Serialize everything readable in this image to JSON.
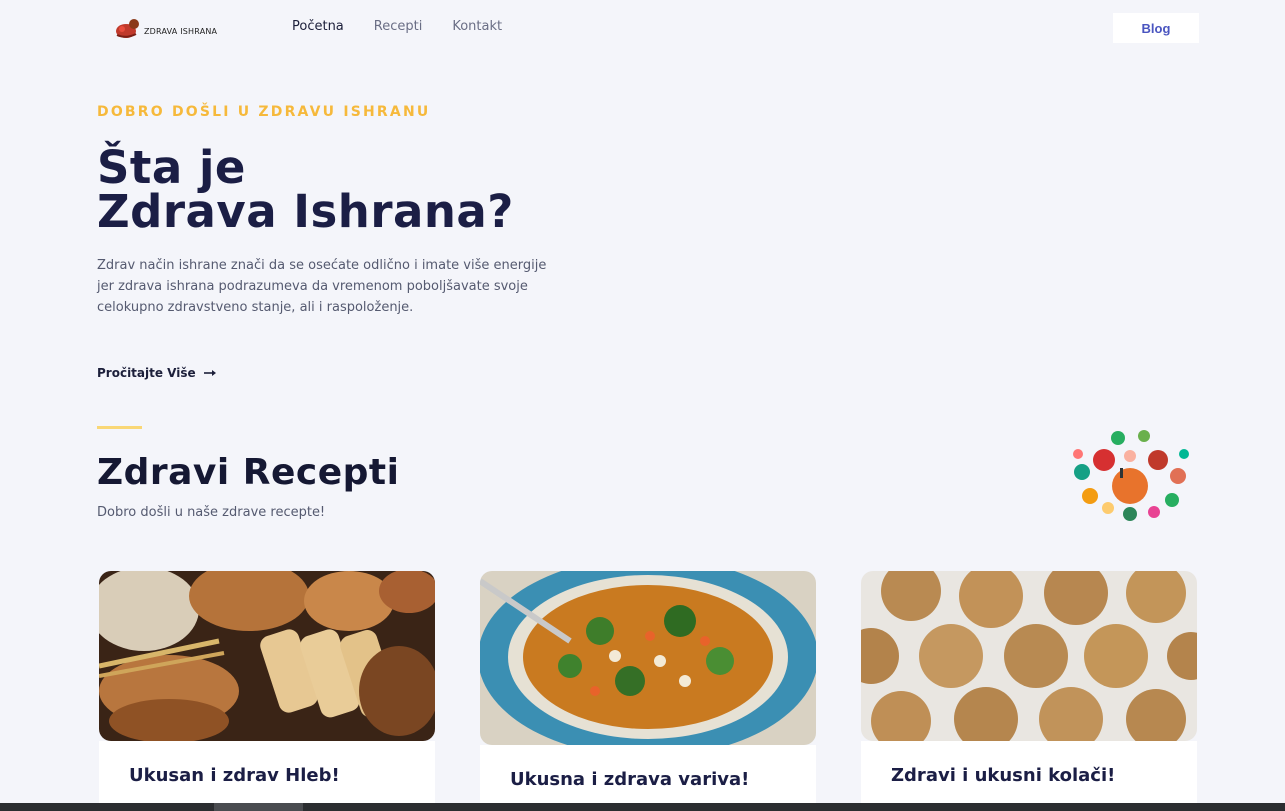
{
  "nav": {
    "logo_text": "ZDRAVA ISHRANA",
    "links": [
      "Početna",
      "Recepti",
      "Kontakt"
    ],
    "blog_label": "Blog"
  },
  "hero": {
    "eyebrow": "DOBRO DOŠLI U ZDRAVU ISHRANU",
    "title_line1": "Šta je",
    "title_line2": "Zdrava Ishrana?",
    "text": "Zdrav način ishrane znači da se osećate odlično i imate više energije jer zdrava ishrana podrazumeva da vremenom poboljšavate svoje celokupno zdravstveno stanje, ali i raspoloženje.",
    "read_more": "Pročitajte Više"
  },
  "recipes": {
    "title": "Zdravi Recepti",
    "subtitle": "Dobro došli u naše zdrave recepte!",
    "cards": [
      {
        "title": "Ukusan i zdrav Hleb!"
      },
      {
        "title": "Ukusna i zdrava variva!"
      },
      {
        "title": "Zdravi i ukusni kolači!"
      }
    ]
  },
  "colors": {
    "accent_yellow": "#f6b93b",
    "heading_navy": "#1b1e45",
    "blog_blue": "#4a55c0",
    "page_bg": "#f4f5fa"
  },
  "icons": [
    "logo-mark-icon",
    "arrow-right-icon",
    "vegetable-circle-illustration"
  ]
}
